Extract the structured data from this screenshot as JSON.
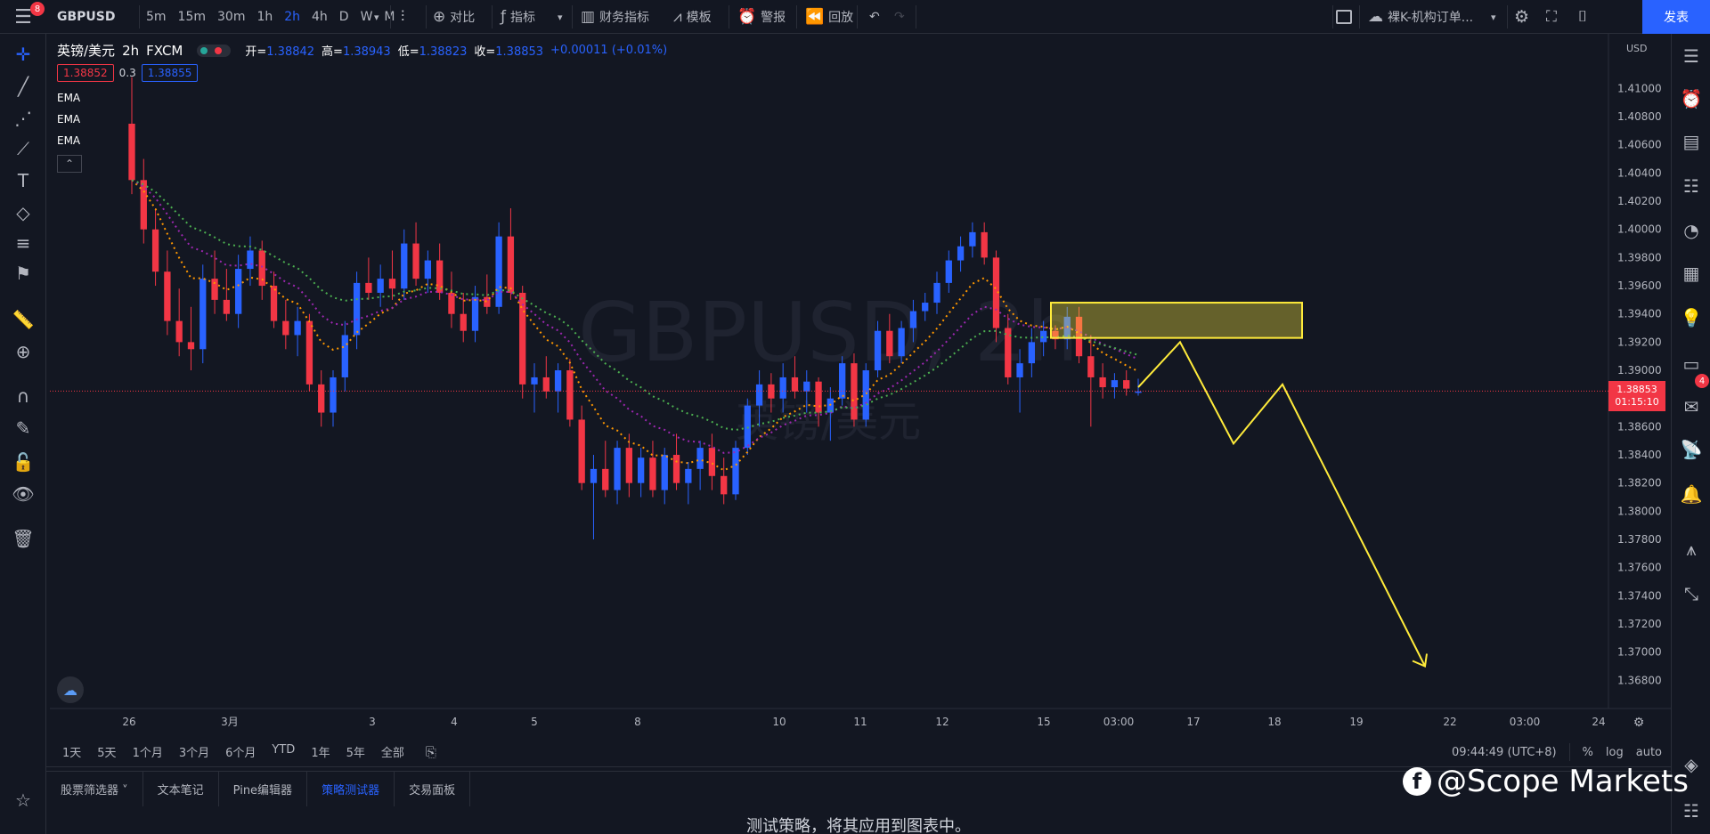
{
  "topbar": {
    "symbol": "GBPUSD",
    "intervals": [
      "5m",
      "15m",
      "30m",
      "1h",
      "2h",
      "4h",
      "D",
      "W",
      "M"
    ],
    "active_interval": "2h",
    "compare_label": "对比",
    "indicators_label": "指标",
    "financials_label": "财务指标",
    "templates_label": "模板",
    "alert_label": "警报",
    "replay_label": "回放",
    "layout_name": "裸K-机构订单...",
    "publish_label": "发表",
    "notification_count": "8"
  },
  "legend": {
    "symbol_name": "英镑/美元",
    "interval": "2h",
    "exchange": "FXCM",
    "open_label": "开=",
    "open": "1.38842",
    "high_label": "高=",
    "high": "1.38943",
    "low_label": "低=",
    "low": "1.38823",
    "close_label": "收=",
    "close": "1.38853",
    "change": "+0.00011 (+0.01%)",
    "bid": "1.38852",
    "spread": "0.3",
    "ask": "1.38855",
    "ema_labels": [
      "EMA",
      "EMA",
      "EMA"
    ]
  },
  "chart_data": {
    "type": "candlestick",
    "watermark_symbol": "GBPUSD, 2h",
    "watermark_name": "英镑/美元",
    "currency": "USD",
    "y_ticks": [
      "1.41000",
      "1.40800",
      "1.40600",
      "1.40400",
      "1.40200",
      "1.40000",
      "1.39800",
      "1.39600",
      "1.39400",
      "1.39200",
      "1.39000",
      "1.38800",
      "1.38600",
      "1.38400",
      "1.38200",
      "1.38000",
      "1.37800",
      "1.37600",
      "1.37400",
      "1.37200",
      "1.37000",
      "1.36800"
    ],
    "ylim": [
      1.366,
      1.4135
    ],
    "x_ticks": [
      "26",
      "3月",
      "3",
      "4",
      "5",
      "8",
      "10",
      "11",
      "12",
      "15",
      "03:00",
      "17",
      "18",
      "19",
      "22",
      "03:00",
      "24"
    ],
    "last_price": "1.38853",
    "countdown": "01:15:10",
    "candles": [
      [
        1.4075,
        1.4108,
        1.4025,
        1.4035
      ],
      [
        1.4035,
        1.405,
        1.399,
        1.4
      ],
      [
        1.4,
        1.4015,
        1.396,
        1.397
      ],
      [
        1.397,
        1.3985,
        1.3925,
        1.3935
      ],
      [
        1.3935,
        1.3958,
        1.391,
        1.392
      ],
      [
        1.392,
        1.3945,
        1.39,
        1.3915
      ],
      [
        1.3915,
        1.3975,
        1.3905,
        1.3965
      ],
      [
        1.3965,
        1.3985,
        1.394,
        1.395
      ],
      [
        1.395,
        1.3972,
        1.3935,
        1.394
      ],
      [
        1.394,
        1.3982,
        1.393,
        1.3972
      ],
      [
        1.3972,
        1.3995,
        1.396,
        1.3985
      ],
      [
        1.3985,
        1.3992,
        1.395,
        1.396
      ],
      [
        1.396,
        1.397,
        1.393,
        1.3935
      ],
      [
        1.3935,
        1.395,
        1.3915,
        1.3925
      ],
      [
        1.3925,
        1.3945,
        1.391,
        1.3935
      ],
      [
        1.3935,
        1.394,
        1.3885,
        1.389
      ],
      [
        1.389,
        1.39,
        1.386,
        1.387
      ],
      [
        1.387,
        1.39,
        1.386,
        1.3895
      ],
      [
        1.3895,
        1.3935,
        1.3885,
        1.3925
      ],
      [
        1.3925,
        1.397,
        1.3915,
        1.3962
      ],
      [
        1.3962,
        1.398,
        1.395,
        1.3955
      ],
      [
        1.3955,
        1.3975,
        1.3945,
        1.3965
      ],
      [
        1.3965,
        1.3985,
        1.395,
        1.3958
      ],
      [
        1.3958,
        1.4,
        1.395,
        1.399
      ],
      [
        1.399,
        1.4005,
        1.396,
        1.3965
      ],
      [
        1.3965,
        1.3985,
        1.3955,
        1.3978
      ],
      [
        1.3978,
        1.399,
        1.395,
        1.3955
      ],
      [
        1.3955,
        1.397,
        1.393,
        1.394
      ],
      [
        1.394,
        1.3955,
        1.392,
        1.3928
      ],
      [
        1.3928,
        1.396,
        1.392,
        1.3952
      ],
      [
        1.3952,
        1.3968,
        1.394,
        1.3945
      ],
      [
        1.3945,
        1.4005,
        1.394,
        1.3995
      ],
      [
        1.3995,
        1.4015,
        1.395,
        1.3955
      ],
      [
        1.3955,
        1.396,
        1.388,
        1.389
      ],
      [
        1.389,
        1.3905,
        1.387,
        1.3895
      ],
      [
        1.3895,
        1.391,
        1.388,
        1.3885
      ],
      [
        1.3885,
        1.3905,
        1.387,
        1.39
      ],
      [
        1.39,
        1.3908,
        1.386,
        1.3865
      ],
      [
        1.3865,
        1.3875,
        1.3815,
        1.382
      ],
      [
        1.382,
        1.384,
        1.378,
        1.383
      ],
      [
        1.383,
        1.385,
        1.381,
        1.3815
      ],
      [
        1.3815,
        1.385,
        1.3805,
        1.3845
      ],
      [
        1.3845,
        1.3855,
        1.381,
        1.382
      ],
      [
        1.382,
        1.3845,
        1.381,
        1.3838
      ],
      [
        1.3838,
        1.385,
        1.381,
        1.3815
      ],
      [
        1.3815,
        1.3845,
        1.3805,
        1.384
      ],
      [
        1.384,
        1.3855,
        1.3815,
        1.382
      ],
      [
        1.382,
        1.3835,
        1.3805,
        1.383
      ],
      [
        1.383,
        1.385,
        1.3815,
        1.3845
      ],
      [
        1.3845,
        1.3855,
        1.3815,
        1.3825
      ],
      [
        1.3825,
        1.3838,
        1.3805,
        1.3812
      ],
      [
        1.3812,
        1.385,
        1.3808,
        1.3845
      ],
      [
        1.3845,
        1.388,
        1.384,
        1.3875
      ],
      [
        1.3875,
        1.39,
        1.386,
        1.389
      ],
      [
        1.389,
        1.3898,
        1.387,
        1.388
      ],
      [
        1.388,
        1.3905,
        1.387,
        1.3895
      ],
      [
        1.3895,
        1.391,
        1.388,
        1.3885
      ],
      [
        1.3885,
        1.39,
        1.387,
        1.3892
      ],
      [
        1.3892,
        1.3895,
        1.386,
        1.387
      ],
      [
        1.387,
        1.3888,
        1.385,
        1.388
      ],
      [
        1.388,
        1.391,
        1.3875,
        1.3905
      ],
      [
        1.3905,
        1.3912,
        1.386,
        1.3865
      ],
      [
        1.3865,
        1.3905,
        1.386,
        1.39
      ],
      [
        1.39,
        1.3935,
        1.3895,
        1.3928
      ],
      [
        1.3928,
        1.394,
        1.3905,
        1.391
      ],
      [
        1.391,
        1.3935,
        1.3905,
        1.393
      ],
      [
        1.393,
        1.395,
        1.392,
        1.3942
      ],
      [
        1.3942,
        1.3955,
        1.3935,
        1.3948
      ],
      [
        1.3948,
        1.397,
        1.394,
        1.3962
      ],
      [
        1.3962,
        1.3985,
        1.3955,
        1.3978
      ],
      [
        1.3978,
        1.3995,
        1.397,
        1.3988
      ],
      [
        1.3988,
        1.4005,
        1.398,
        1.3998
      ],
      [
        1.3998,
        1.4005,
        1.3975,
        1.398
      ],
      [
        1.398,
        1.3985,
        1.392,
        1.393
      ],
      [
        1.393,
        1.394,
        1.389,
        1.3895
      ],
      [
        1.3895,
        1.3915,
        1.387,
        1.3905
      ],
      [
        1.3905,
        1.393,
        1.3895,
        1.392
      ],
      [
        1.392,
        1.3935,
        1.391,
        1.3928
      ],
      [
        1.3928,
        1.3932,
        1.3915,
        1.3922
      ],
      [
        1.3922,
        1.3945,
        1.3915,
        1.3938
      ],
      [
        1.3938,
        1.3945,
        1.3905,
        1.391
      ],
      [
        1.391,
        1.3925,
        1.386,
        1.3895
      ],
      [
        1.3895,
        1.3905,
        1.388,
        1.3888
      ],
      [
        1.3888,
        1.3898,
        1.388,
        1.3893
      ],
      [
        1.3893,
        1.39,
        1.3882,
        1.3887
      ],
      [
        1.3884,
        1.3894,
        1.3882,
        1.3885
      ]
    ],
    "drawings": {
      "zone_high": 1.3948,
      "zone_low": 1.3923,
      "projection": [
        [
          1.3888
        ],
        [
          1.392
        ],
        [
          1.3848
        ],
        [
          1.389
        ],
        [
          1.369
        ]
      ]
    }
  },
  "range_bar": {
    "ranges": [
      "1天",
      "5天",
      "1个月",
      "3个月",
      "6个月",
      "YTD",
      "1年",
      "5年",
      "全部"
    ],
    "time": "09:44:49 (UTC+8)",
    "pct": "%",
    "log": "log",
    "auto": "auto"
  },
  "bottom_tabs": {
    "tabs": [
      "股票筛选器",
      "文本笔记",
      "Pine编辑器",
      "策略测试器",
      "交易面板"
    ],
    "active": "策略测试器",
    "strategy_hint": "测试策略，将其应用到图表中。"
  },
  "watermark_brand": "@Scope Markets",
  "right_badge": "4",
  "colors": {
    "up": "#2962ff",
    "down": "#f23645",
    "ema_orange": "#ff9800",
    "ema_purple": "#9c27b0",
    "ema_green": "#4caf50",
    "drawing": "#ffeb3b"
  }
}
